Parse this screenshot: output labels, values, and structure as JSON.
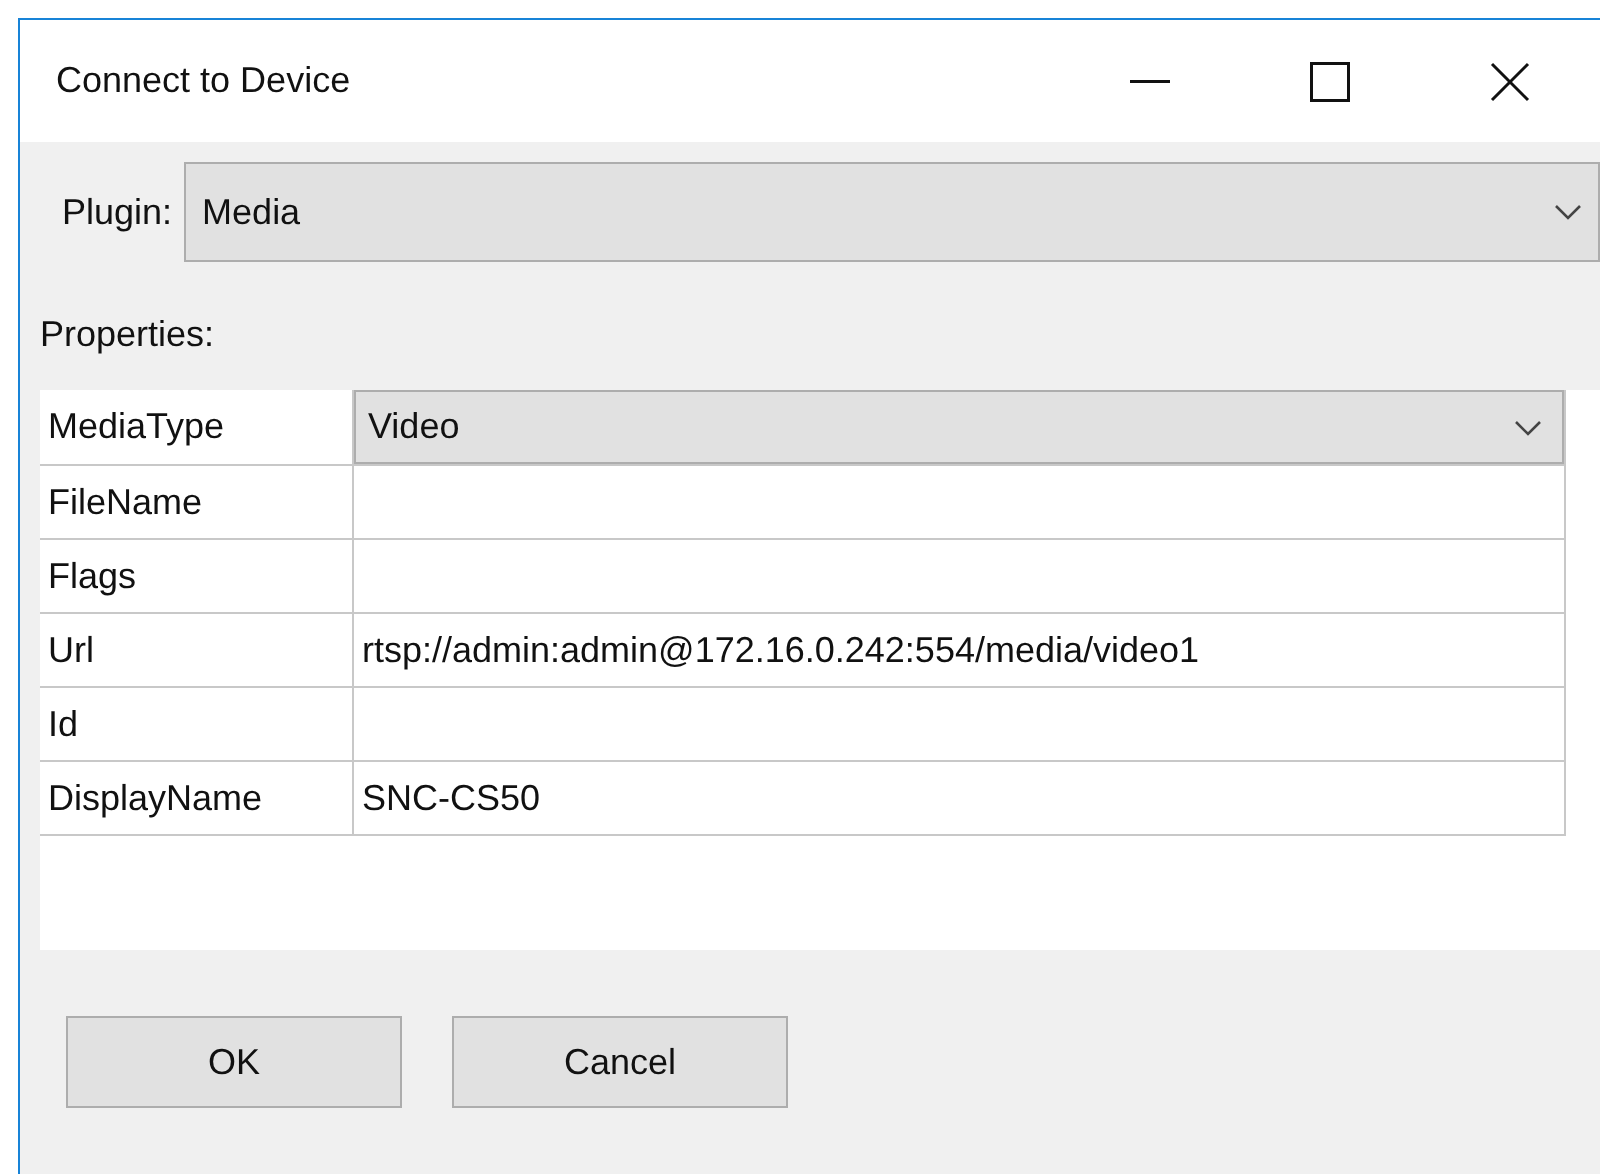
{
  "window": {
    "title": "Connect to Device"
  },
  "plugin": {
    "label": "Plugin:",
    "value": "Media"
  },
  "properties": {
    "label": "Properties:",
    "rows": [
      {
        "name": "MediaType",
        "kind": "combo",
        "value": "Video"
      },
      {
        "name": "FileName",
        "kind": "text"
      },
      {
        "name": "Flags",
        "kind": "text"
      },
      {
        "name": "Url",
        "kind": "text",
        "value": "rtsp://admin:admin@172.16.0.242:554/media/video1"
      },
      {
        "name": "Id",
        "kind": "text"
      },
      {
        "name": "DisplayName",
        "kind": "text",
        "value": "SNC-CS50"
      }
    ]
  },
  "buttons": [
    "OK",
    "Cancel"
  ]
}
